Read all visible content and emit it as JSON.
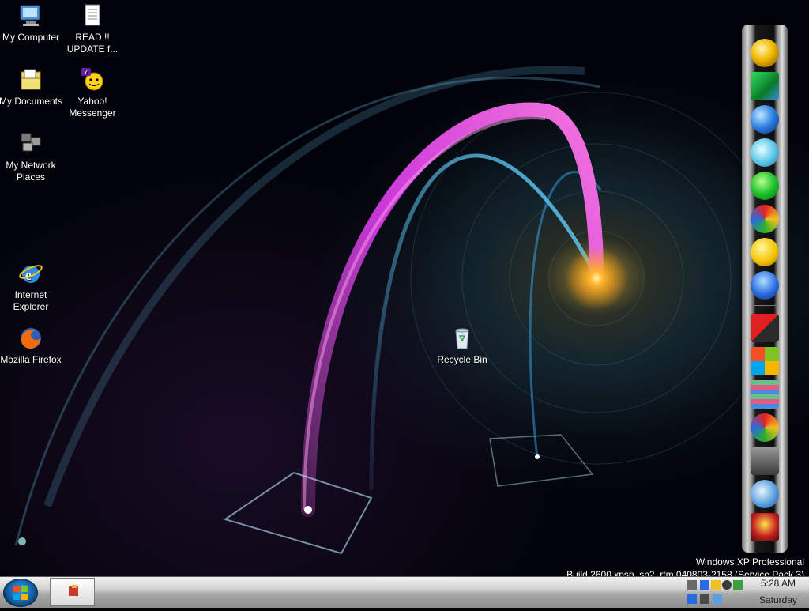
{
  "desktop": {
    "icons": [
      {
        "id": "my-computer",
        "label": "My Computer"
      },
      {
        "id": "read-update",
        "label": "READ !! UPDATE f..."
      },
      {
        "id": "my-documents",
        "label": "My Documents"
      },
      {
        "id": "yahoo-messenger",
        "label": "Yahoo! Messenger"
      },
      {
        "id": "my-network-places",
        "label": "My Network Places"
      },
      {
        "id": "internet-explorer",
        "label": "Internet Explorer"
      },
      {
        "id": "mozilla-firefox",
        "label": "Mozilla Firefox"
      },
      {
        "id": "recycle-bin",
        "label": "Recycle Bin"
      }
    ]
  },
  "dock": {
    "items": [
      "gold-orb-icon",
      "monitor-icon",
      "globe-icon",
      "media-player-icon",
      "ie-green-icon",
      "media-center-icon",
      "messenger-smiley-icon",
      "msn-buddy-icon",
      "windows-media-icon",
      "windows-flag-icon",
      "stacked-books-icon",
      "butterfly-icon",
      "printer-icon",
      "network-icon",
      "aim-man-icon"
    ]
  },
  "watermark": {
    "line1": "Windows XP Professional",
    "line2": "Build 2600.xpsp_sp2_rtm.040803-2158 (Service Pack 3)"
  },
  "taskbar": {
    "clock_time": "5:28 AM",
    "clock_day": "Saturday"
  },
  "colors": {
    "arc_blue": "#3bb6ff",
    "arc_magenta": "#d23fe6",
    "dock_dark": "#0d0d0d",
    "taskbar_light": "#d0d0d0"
  }
}
